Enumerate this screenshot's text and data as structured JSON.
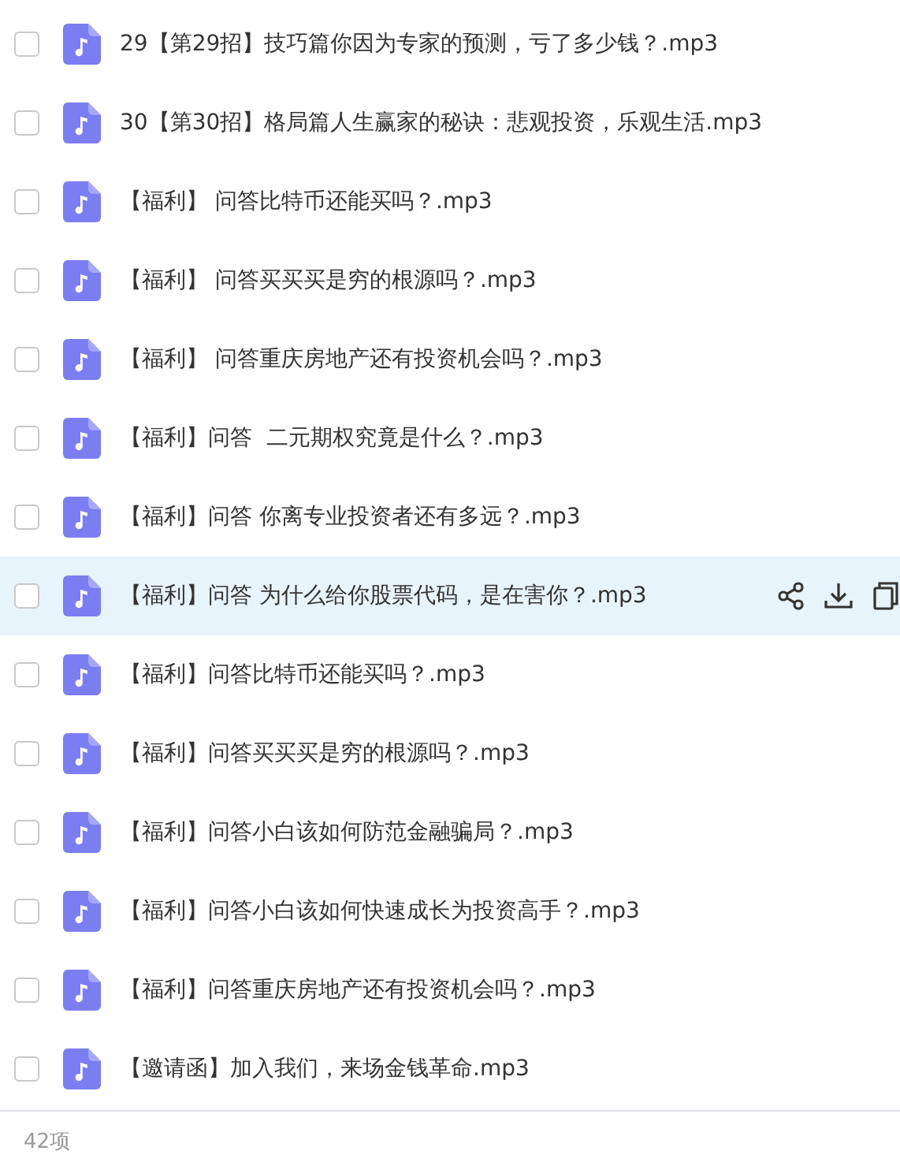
{
  "files": [
    {
      "name": "29【第29招】技巧篇你因为专家的预测，亏了多少钱？.mp3",
      "checked": false,
      "selected": false
    },
    {
      "name": "30【第30招】格局篇人生赢家的秘诀：悲观投资，乐观生活.mp3",
      "checked": false,
      "selected": false
    },
    {
      "name": "【福利】 问答比特币还能买吗？.mp3",
      "checked": false,
      "selected": false
    },
    {
      "name": "【福利】 问答买买买是穷的根源吗？.mp3",
      "checked": false,
      "selected": false
    },
    {
      "name": "【福利】 问答重庆房地产还有投资机会吗？.mp3",
      "checked": false,
      "selected": false
    },
    {
      "name": "【福利】问答  二元期权究竟是什么？.mp3",
      "checked": false,
      "selected": false
    },
    {
      "name": "【福利】问答 你离专业投资者还有多远？.mp3",
      "checked": false,
      "selected": false
    },
    {
      "name": "【福利】问答 为什么给你股票代码，是在害你？.mp3",
      "checked": false,
      "selected": true
    },
    {
      "name": "【福利】问答比特币还能买吗？.mp3",
      "checked": false,
      "selected": false
    },
    {
      "name": "【福利】问答买买买是穷的根源吗？.mp3",
      "checked": false,
      "selected": false
    },
    {
      "name": "【福利】问答小白该如何防范金融骗局？.mp3",
      "checked": false,
      "selected": false
    },
    {
      "name": "【福利】问答小白该如何快速成长为投资高手？.mp3",
      "checked": false,
      "selected": false
    },
    {
      "name": "【福利】问答重庆房地产还有投资机会吗？.mp3",
      "checked": false,
      "selected": false
    },
    {
      "name": "【邀请函】加入我们，来场金钱革命.mp3",
      "checked": false,
      "selected": false
    }
  ],
  "footer": {
    "count": "42项"
  }
}
